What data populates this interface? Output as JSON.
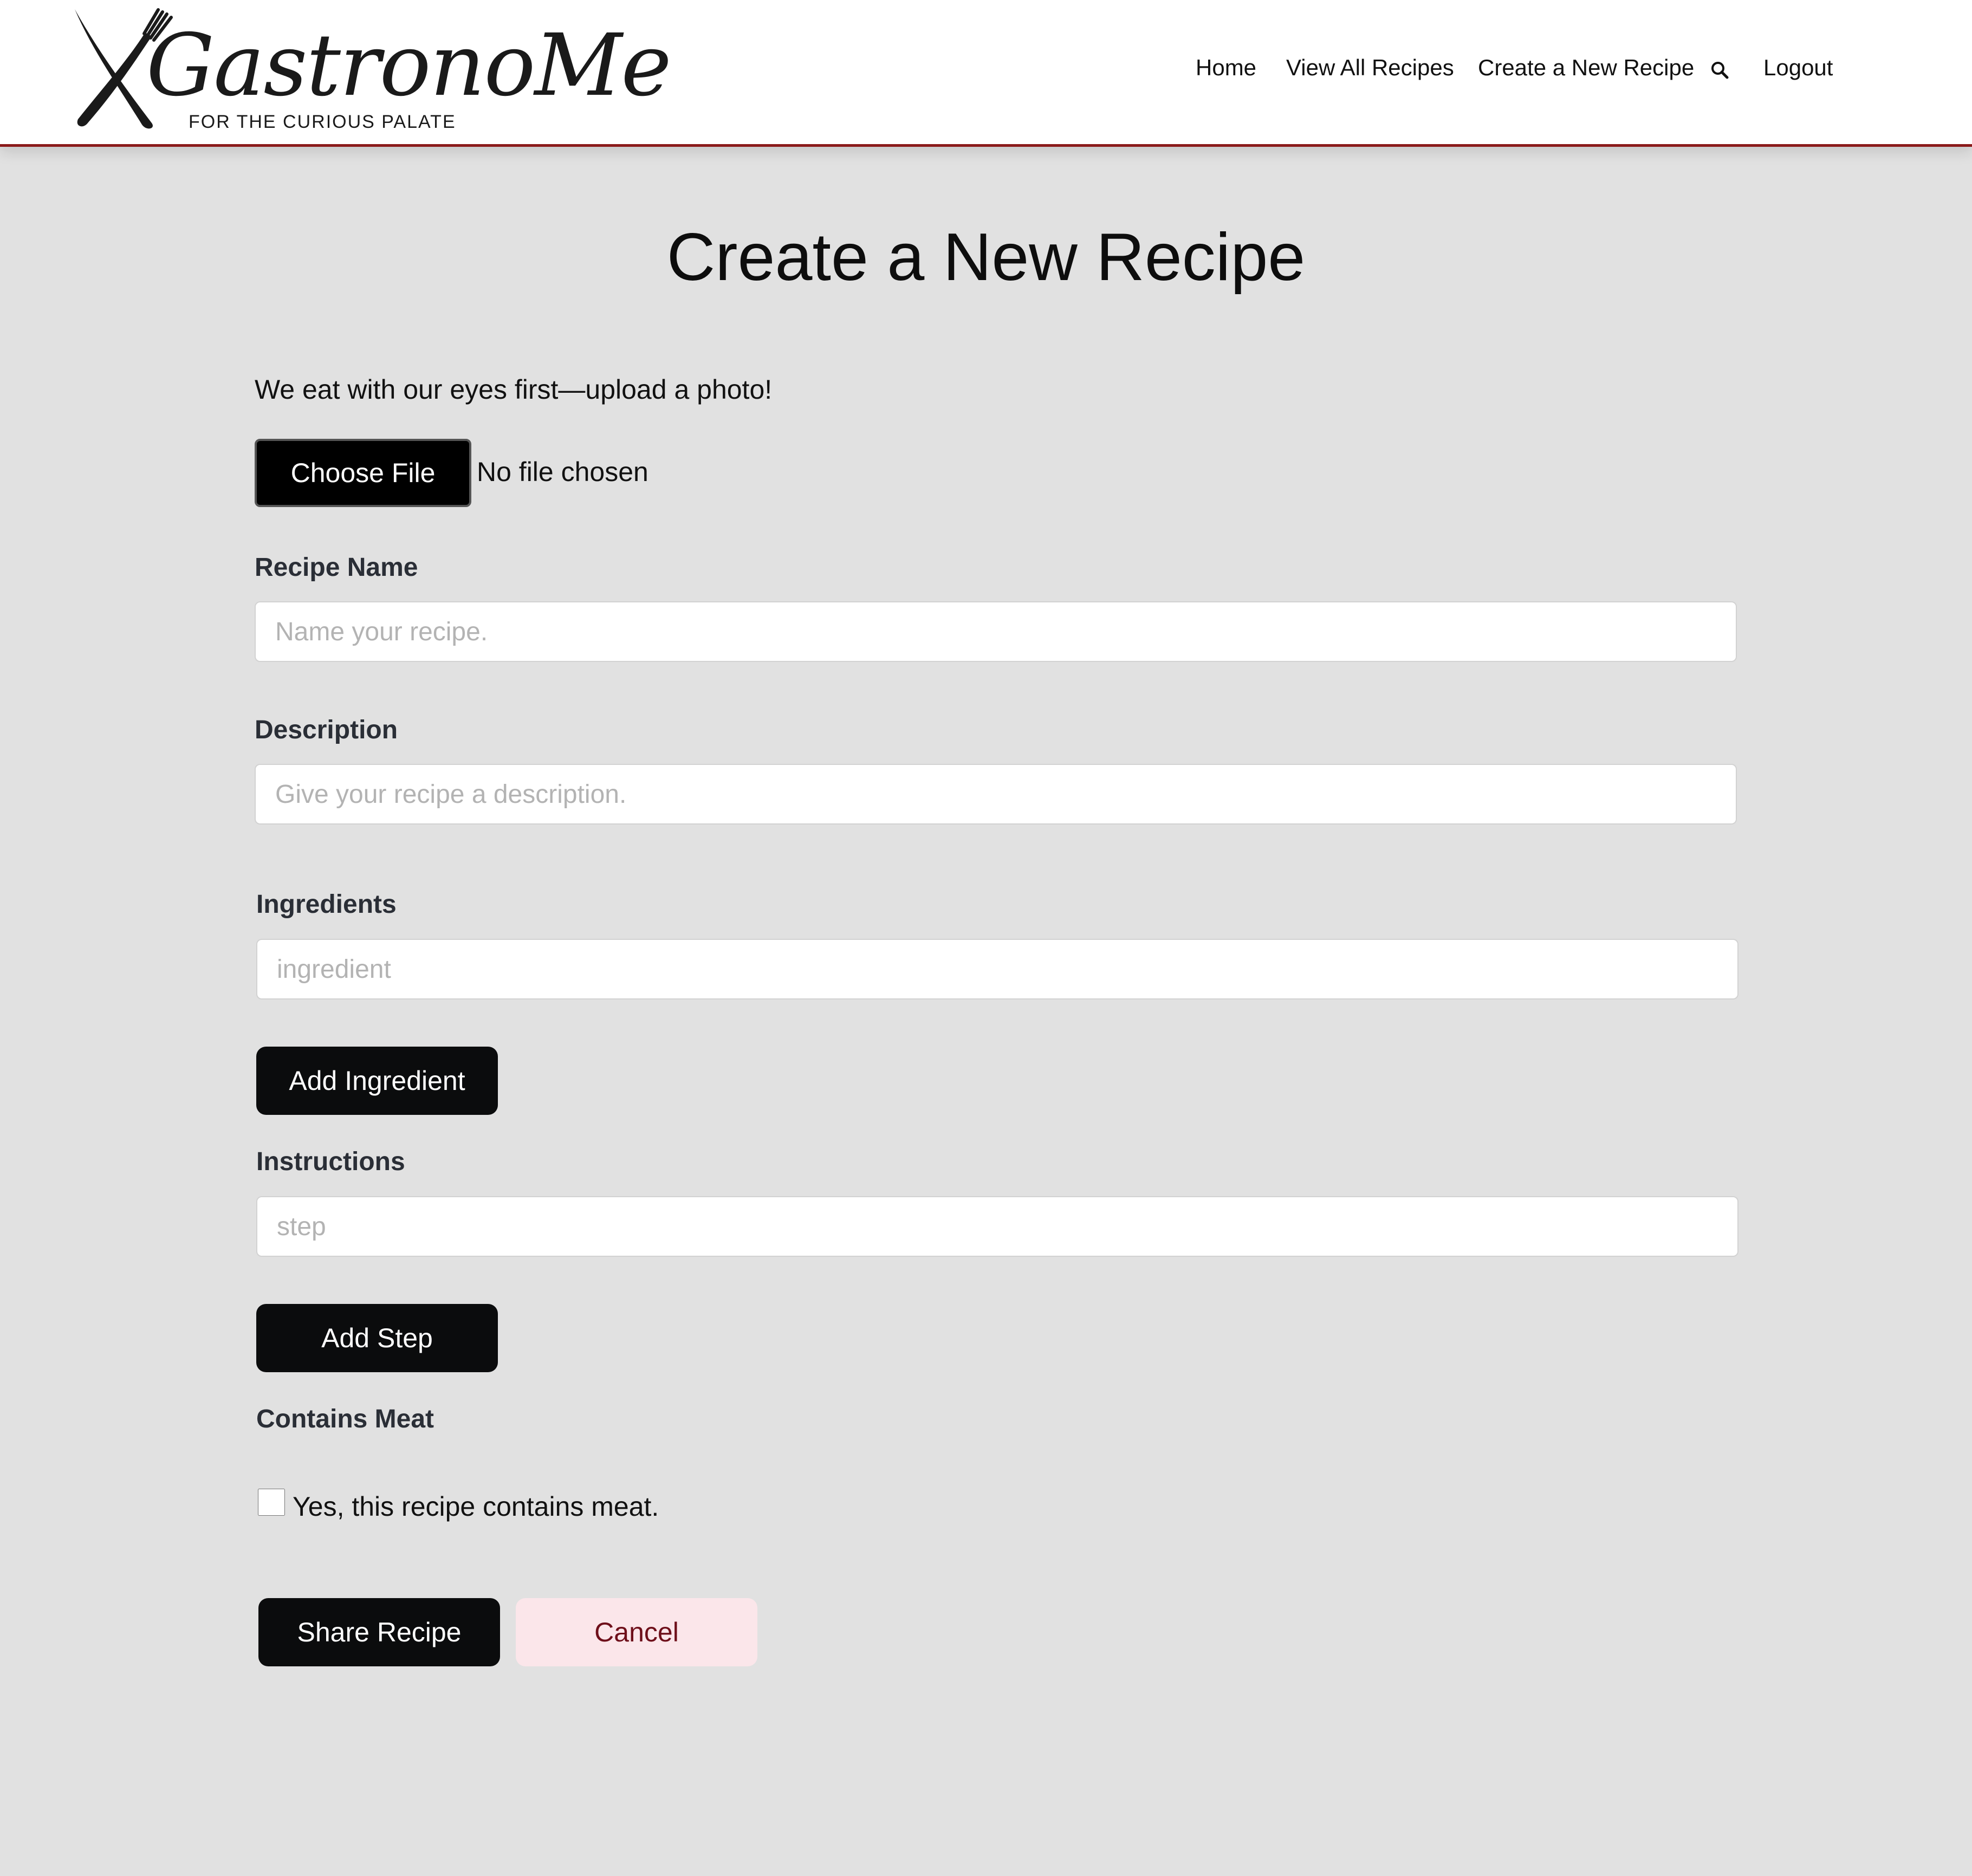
{
  "header": {
    "logo": {
      "wordmark": "GastronoMe",
      "tagline": "FOR THE CURIOUS PALATE"
    },
    "nav": [
      {
        "label": "Home"
      },
      {
        "label": "View All Recipes"
      },
      {
        "label": "Create a New Recipe"
      },
      {
        "label": "Logout"
      }
    ],
    "search_icon": "search-icon",
    "accent_color": "#8b1a1a"
  },
  "main": {
    "title": "Create a New Recipe",
    "photo": {
      "prompt": "We eat with our eyes first—upload a photo!",
      "button_label": "Choose File",
      "status": "No file chosen"
    },
    "recipe_name": {
      "label": "Recipe Name",
      "placeholder": "Name your recipe.",
      "value": ""
    },
    "description": {
      "label": "Description",
      "placeholder": "Give your recipe a description.",
      "value": ""
    },
    "ingredients": {
      "label": "Ingredients",
      "placeholder": "ingredient",
      "value": "",
      "add_label": "Add Ingredient"
    },
    "instructions": {
      "label": "Instructions",
      "placeholder": "step",
      "value": "",
      "add_label": "Add Step"
    },
    "contains_meat": {
      "label": "Contains Meat",
      "checkbox_label": "Yes, this recipe contains meat.",
      "checked": false
    },
    "actions": {
      "share_label": "Share Recipe",
      "cancel_label": "Cancel"
    }
  },
  "colors": {
    "page_background": "#e1e1e1",
    "button_dark": "#0b0c0d",
    "cancel_background": "#fbe6ea",
    "cancel_text": "#6e0f1a"
  }
}
